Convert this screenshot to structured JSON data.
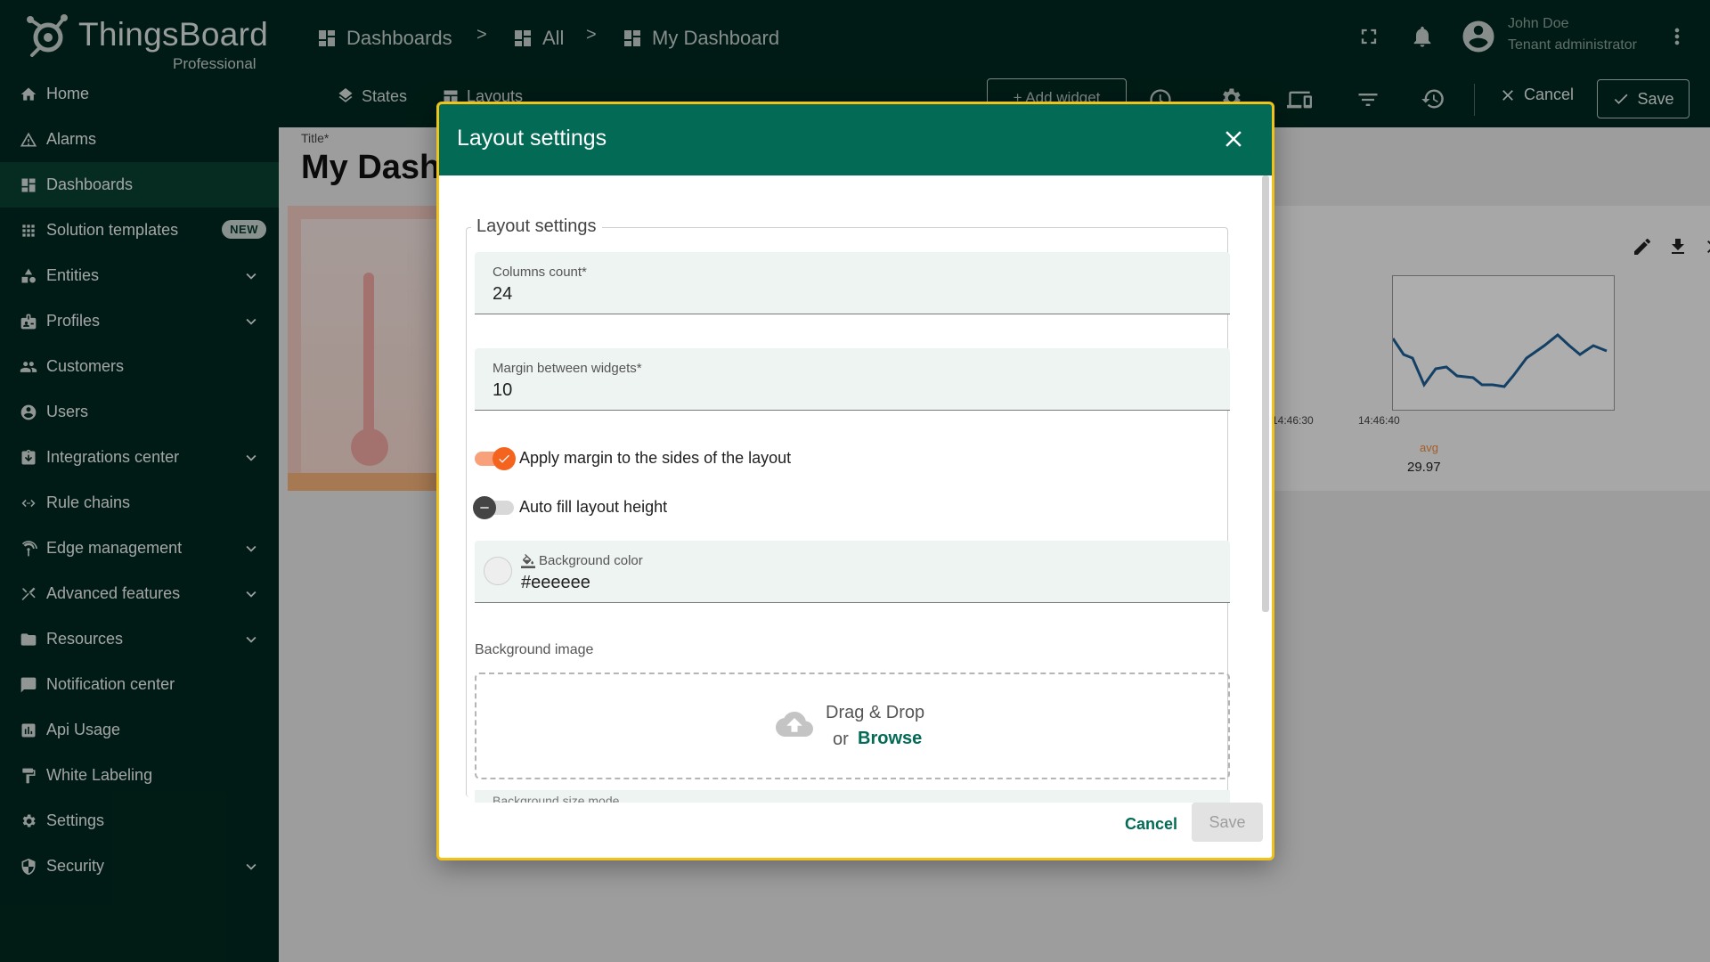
{
  "app": {
    "logo_title": "ThingsBoard",
    "logo_subtitle": "Professional"
  },
  "sidebar": {
    "items": [
      {
        "label": "Home",
        "icon": "home-icon",
        "active": false,
        "expandable": false
      },
      {
        "label": "Alarms",
        "icon": "alarm-icon",
        "active": false,
        "expandable": false
      },
      {
        "label": "Dashboards",
        "icon": "dashboards-icon",
        "active": true,
        "expandable": false
      },
      {
        "label": "Solution templates",
        "icon": "grid-icon",
        "active": false,
        "expandable": false,
        "badge": "NEW"
      },
      {
        "label": "Entities",
        "icon": "entities-icon",
        "active": false,
        "expandable": true
      },
      {
        "label": "Profiles",
        "icon": "profiles-icon",
        "active": false,
        "expandable": true
      },
      {
        "label": "Customers",
        "icon": "customers-icon",
        "active": false,
        "expandable": false
      },
      {
        "label": "Users",
        "icon": "users-icon",
        "active": false,
        "expandable": false
      },
      {
        "label": "Integrations center",
        "icon": "integrations-icon",
        "active": false,
        "expandable": true
      },
      {
        "label": "Rule chains",
        "icon": "rule-chains-icon",
        "active": false,
        "expandable": false
      },
      {
        "label": "Edge management",
        "icon": "edge-icon",
        "active": false,
        "expandable": true
      },
      {
        "label": "Advanced features",
        "icon": "tools-icon",
        "active": false,
        "expandable": true
      },
      {
        "label": "Resources",
        "icon": "folder-icon",
        "active": false,
        "expandable": true
      },
      {
        "label": "Notification center",
        "icon": "notification-icon",
        "active": false,
        "expandable": false
      },
      {
        "label": "Api Usage",
        "icon": "chart-icon",
        "active": false,
        "expandable": false
      },
      {
        "label": "White Labeling",
        "icon": "paint-roller-icon",
        "active": false,
        "expandable": false
      },
      {
        "label": "Settings",
        "icon": "gear-icon",
        "active": false,
        "expandable": false
      },
      {
        "label": "Security",
        "icon": "shield-icon",
        "active": false,
        "expandable": true
      }
    ]
  },
  "topbar": {
    "breadcrumbs": [
      "Dashboards",
      "All",
      "My Dashboard"
    ],
    "breadcrumb_separator": ">",
    "user_name": "John Doe",
    "user_role": "Tenant administrator",
    "states_label": "States",
    "layouts_label": "Layouts",
    "add_widget_label": "+ Add widget",
    "cancel_label": "Cancel",
    "save_label": "Save"
  },
  "dashboard": {
    "title_label": "Title*",
    "title": "My Dashboard",
    "chart_ticks": [
      "14:46:30",
      "14:46:40"
    ],
    "avg_label": "avg",
    "avg_value": "29.97"
  },
  "dialog": {
    "title": "Layout settings",
    "fieldset_legend": "Layout settings",
    "columns_count": {
      "label": "Columns count*",
      "value": "24"
    },
    "margin": {
      "label": "Margin between widgets*",
      "value": "10"
    },
    "apply_margin": {
      "label": "Apply margin to the sides of the layout",
      "checked": true
    },
    "auto_fill": {
      "label": "Auto fill layout height",
      "checked": false
    },
    "background_color": {
      "label": "Background color",
      "value": "#eeeeee"
    },
    "background_image_label": "Background image",
    "dropzone": {
      "title": "Drag & Drop",
      "or": "or",
      "browse": "Browse"
    },
    "next_field_label": "Background size mode",
    "cancel_label": "Cancel",
    "save_label": "Save"
  },
  "colors": {
    "sidebar_bg": "#00291f",
    "accent": "#036a55",
    "toggle_on": "#f5641e",
    "dialog_border": "#f0c21a"
  }
}
